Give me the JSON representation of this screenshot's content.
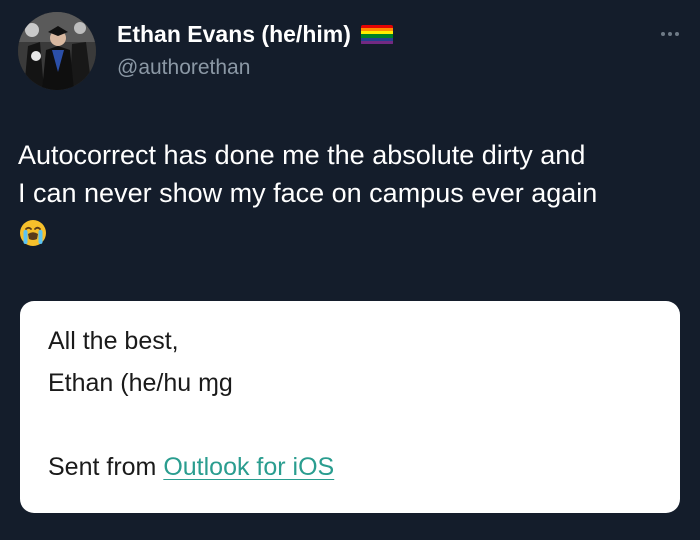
{
  "author": {
    "display_name": "Ethan Evans (he/him)",
    "handle": "@authorethan",
    "badge_icon": "pride-flag-icon",
    "badge_colors": [
      "#e40303",
      "#ff8c00",
      "#ffed00",
      "#008026",
      "#24408e",
      "#732982"
    ]
  },
  "tweet": {
    "lines": [
      "Autocorrect has done me the absolute dirty and",
      "I can never show my face on campus ever again"
    ],
    "emoji_icon": "crying-face-icon"
  },
  "email_card": {
    "signoff": "All the best,",
    "signature": "Ethan (he/hu ɱg",
    "sent_prefix": "Sent from ",
    "sent_link": "Outlook for iOS",
    "link_color": "#2a9d8f"
  },
  "colors": {
    "background": "#141d2b",
    "handle": "#8b98a5"
  }
}
